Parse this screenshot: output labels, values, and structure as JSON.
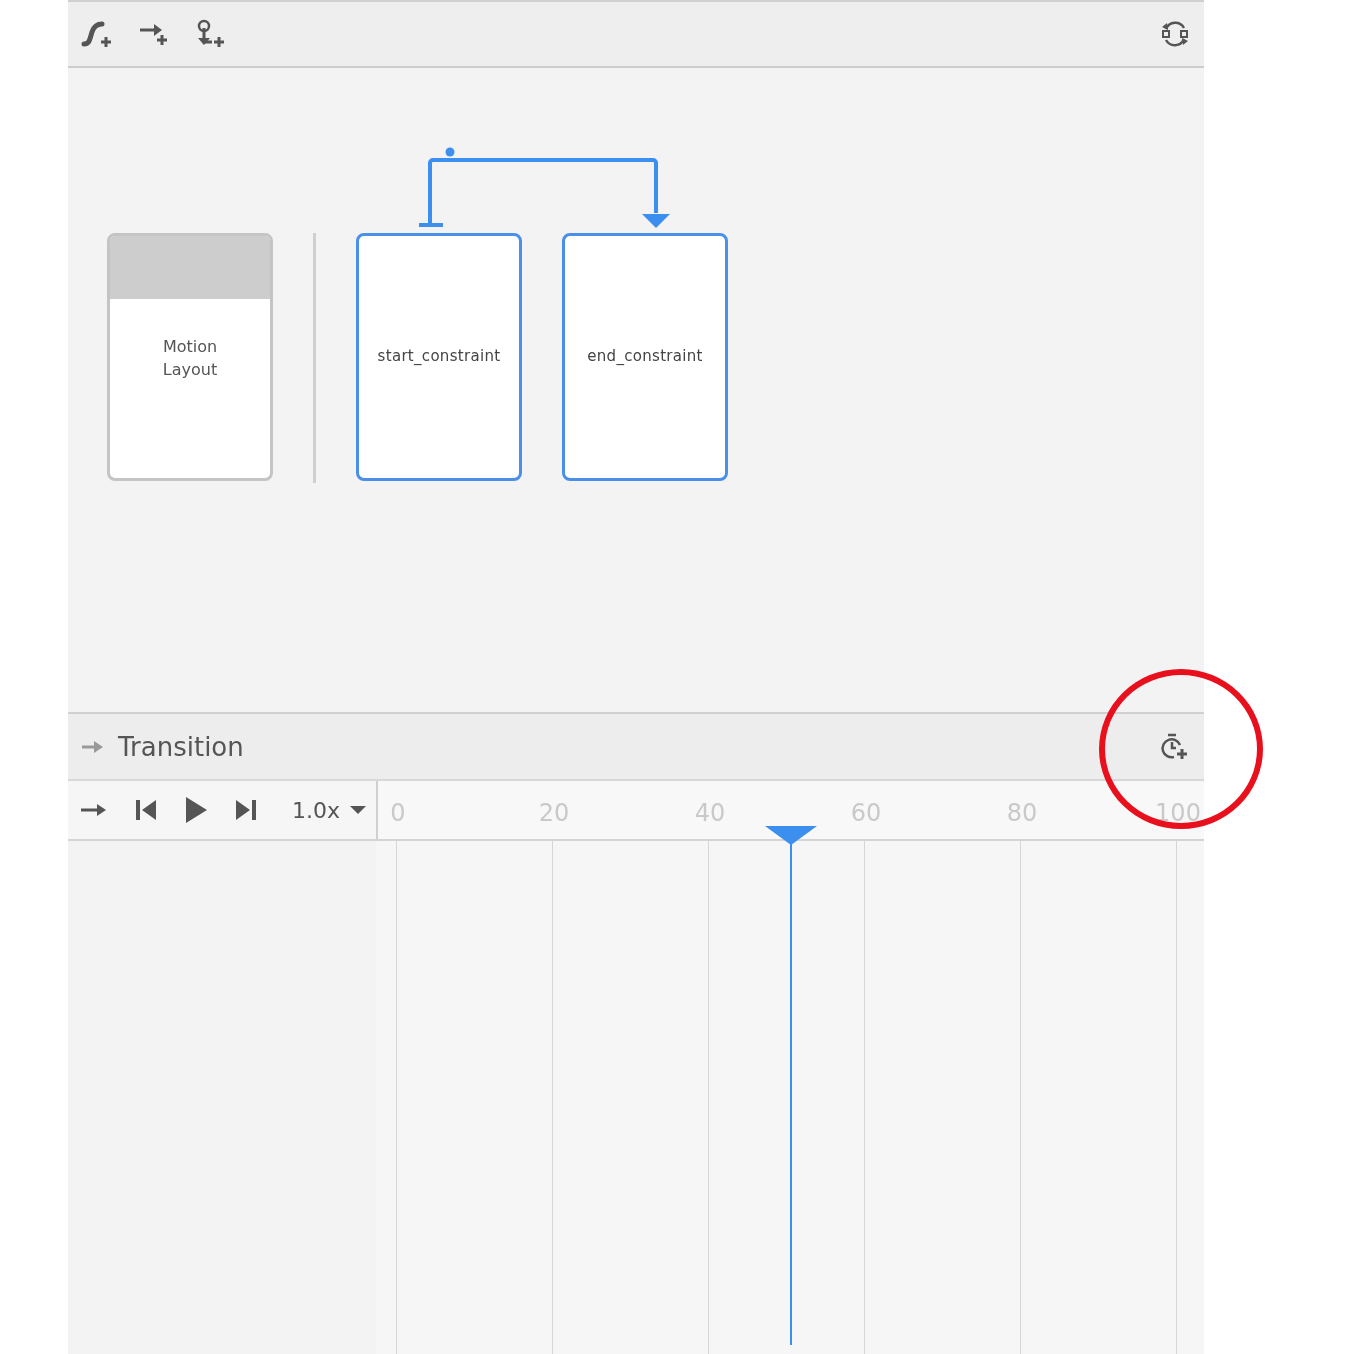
{
  "layout_card": {
    "label": "Motion Layout"
  },
  "constraint_sets": [
    {
      "name": "start_constraint"
    },
    {
      "name": "end_constraint"
    }
  ],
  "transition_panel": {
    "title": "Transition",
    "speed": "1.0x",
    "ticks": [
      "0",
      "20",
      "40",
      "60",
      "80",
      "100"
    ],
    "playhead": {
      "level": 0.506
    }
  }
}
